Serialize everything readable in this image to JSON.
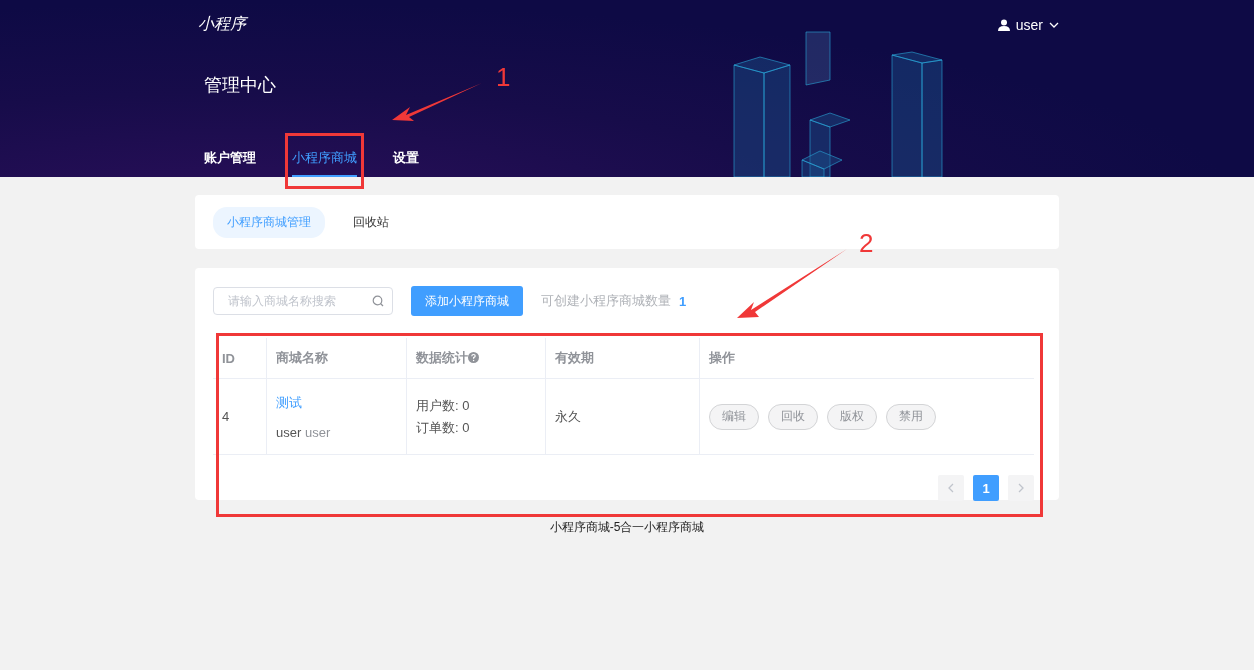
{
  "header": {
    "logo": "小程序",
    "user": "user",
    "title": "管理中心",
    "tabs": [
      {
        "label": "账户管理",
        "selected": false
      },
      {
        "label": "小程序商城",
        "selected": true
      },
      {
        "label": "设置",
        "selected": false
      }
    ]
  },
  "subtabs": [
    {
      "label": "小程序商城管理",
      "selected": true
    },
    {
      "label": "回收站",
      "selected": false
    }
  ],
  "toolbar": {
    "search": {
      "placeholder": "请输入商城名称搜索"
    },
    "add_button": "添加小程序商城",
    "quota_label": "可创建小程序商城数量",
    "quota_value": "1"
  },
  "table": {
    "columns": [
      "ID",
      "商城名称",
      "数据统计",
      "有效期",
      "操作"
    ],
    "rows": [
      {
        "id": "4",
        "name": "测试",
        "owner": "user",
        "owner_2": "user",
        "users": "用户数: 0",
        "orders": "订单数: 0",
        "validity": "永久",
        "actions": [
          "编辑",
          "回收",
          "版权",
          "禁用"
        ]
      }
    ]
  },
  "pagination": {
    "pages": [
      {
        "label": "1",
        "selected": true
      }
    ]
  },
  "footer": "小程序商城-5合一小程序商城",
  "annotations": [
    {
      "label": "1"
    },
    {
      "label": "2"
    }
  ]
}
